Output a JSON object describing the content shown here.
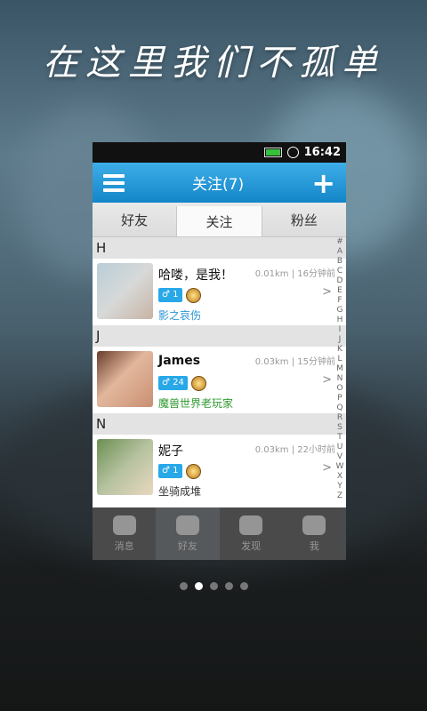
{
  "headline": "在这里我们不孤单",
  "status_bar": {
    "time": "16:42"
  },
  "titlebar": {
    "title": "关注(7)"
  },
  "tabs": [
    {
      "label": "好友"
    },
    {
      "label": "关注"
    },
    {
      "label": "粉丝"
    }
  ],
  "sections": [
    {
      "letter": "H"
    },
    {
      "letter": "J"
    },
    {
      "letter": "N"
    }
  ],
  "contacts": [
    {
      "name": "哈喽，是我！",
      "meta": "0.01km | 16分钟前",
      "level": "1",
      "status": "影之哀伤",
      "status_color": "#2a95d8"
    },
    {
      "name": "James",
      "meta": "0.03km | 15分钟前",
      "level": "24",
      "status": "魔兽世界老玩家",
      "status_color": "#2e9a2e"
    },
    {
      "name": "妮子",
      "meta": "0.03km | 22小时前",
      "level": "1",
      "status": "坐骑成堆",
      "status_color": "#333333"
    }
  ],
  "az_index": "#ABCDEFGHIJKLMNOPQRSTUVWXYZ",
  "bottom_nav": [
    {
      "label": "消息"
    },
    {
      "label": "好友"
    },
    {
      "label": "发现"
    },
    {
      "label": "我"
    }
  ],
  "pager": {
    "active": 1,
    "count": 5
  }
}
